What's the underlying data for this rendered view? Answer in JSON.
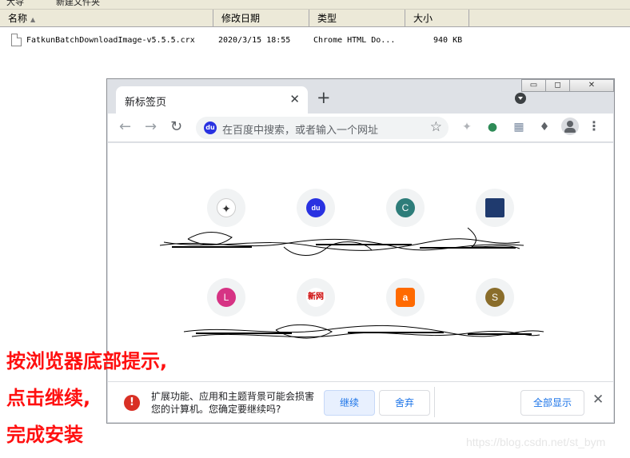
{
  "explorer": {
    "toolbar_items": [
      "大导",
      "新建文件夹"
    ],
    "columns": [
      "名称",
      "修改日期",
      "类型",
      "大小"
    ],
    "sort_indicator": "▲",
    "rows": [
      {
        "name": "FatkunBatchDownloadImage-v5.5.5.crx",
        "modified": "2020/3/15 18:55",
        "type": "Chrome HTML Do...",
        "size": "940 KB"
      }
    ]
  },
  "chrome": {
    "window_controls": {
      "minimize": "▭",
      "maximize": "◻",
      "close": "✕"
    },
    "tab": {
      "title": "新标签页",
      "close": "✕"
    },
    "new_tab": "+",
    "nav": {
      "back": "←",
      "forward": "→",
      "reload": "↻"
    },
    "omnibox": {
      "engine_icon": "du",
      "placeholder": "在百度中搜索，或者输入一个网址"
    },
    "star": "☆",
    "menu": "⋮",
    "shortcuts": [
      {
        "letter": "",
        "color": "#f1f3f4",
        "icon": "bird-logo-icon"
      },
      {
        "letter": "du",
        "color": "#2932e1",
        "icon": "baidu-paw-icon"
      },
      {
        "letter": "C",
        "color": "#2e7d7a",
        "icon": "letter-icon"
      },
      {
        "letter": "",
        "color": "#1f3a6e",
        "icon": "image-thumbnail-icon"
      },
      {
        "letter": "L",
        "color": "#d63384",
        "icon": "letter-icon"
      },
      {
        "letter": "新网",
        "color": "#ffffff",
        "icon": "xinnet-logo-icon"
      },
      {
        "letter": "a",
        "color": "#ff6a00",
        "icon": "aliyun-logo-icon"
      },
      {
        "letter": "S",
        "color": "#8a6d2b",
        "icon": "letter-icon"
      }
    ],
    "infobar": {
      "warning_icon": "!",
      "message": "扩展功能、应用和主题背景可能会损害您的计算机。您确定要继续吗?",
      "continue_label": "继续",
      "discard_label": "舍弃",
      "show_all_label": "全部显示",
      "close": "✕"
    }
  },
  "annotation": {
    "lines": [
      "按浏览器底部提示,",
      "点击继续,",
      "完成安装"
    ]
  },
  "watermark": "https://blog.csdn.net/st_bym",
  "colors": {
    "accent": "#1a73e8",
    "warning": "#d93025",
    "annotation": "#ff1010"
  }
}
